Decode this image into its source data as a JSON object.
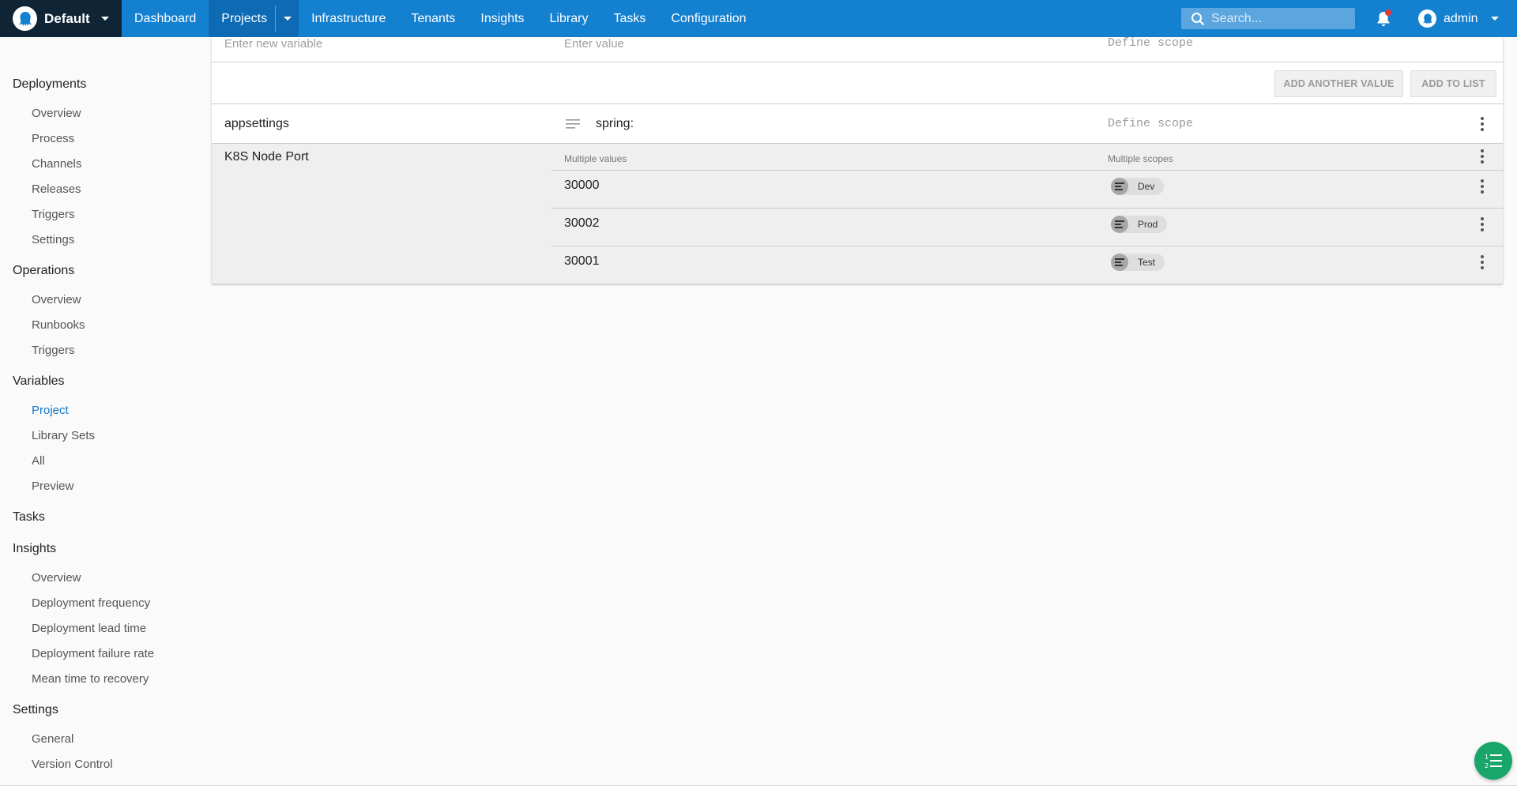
{
  "topbar": {
    "space_name": "Default",
    "nav": [
      "Dashboard",
      "Projects",
      "Infrastructure",
      "Tenants",
      "Insights",
      "Library",
      "Tasks",
      "Configuration"
    ],
    "search_placeholder": "Search...",
    "user_name": "admin"
  },
  "sidebar": {
    "deployments": {
      "title": "Deployments",
      "items": [
        "Overview",
        "Process",
        "Channels",
        "Releases",
        "Triggers",
        "Settings"
      ]
    },
    "operations": {
      "title": "Operations",
      "items": [
        "Overview",
        "Runbooks",
        "Triggers"
      ]
    },
    "variables": {
      "title": "Variables",
      "items": [
        "Project",
        "Library Sets",
        "All",
        "Preview"
      ],
      "selected": "Project"
    },
    "tasks": {
      "title": "Tasks"
    },
    "insights": {
      "title": "Insights",
      "items": [
        "Overview",
        "Deployment frequency",
        "Deployment lead time",
        "Deployment failure rate",
        "Mean time to recovery"
      ]
    },
    "settings": {
      "title": "Settings",
      "items": [
        "General",
        "Version Control"
      ]
    }
  },
  "editor": {
    "new_variable_placeholder": "Enter new variable",
    "new_value_placeholder": "Enter value",
    "new_scope_placeholder": "Define scope",
    "add_another_value": "ADD ANOTHER VALUE",
    "add_to_list": "ADD TO LIST"
  },
  "variables": [
    {
      "name": "appsettings",
      "value": "spring:",
      "scope": "Define scope"
    },
    {
      "name": "K8S Node Port",
      "values_header": "Multiple values",
      "scopes_header": "Multiple scopes",
      "values": [
        {
          "value": "30000",
          "scope": "Dev"
        },
        {
          "value": "30002",
          "scope": "Prod"
        },
        {
          "value": "30001",
          "scope": "Test"
        }
      ]
    }
  ],
  "colors": {
    "topbar": "#1480d0",
    "space_switcher": "#0f2535",
    "selected_link": "#1478c8",
    "fab": "#1aa66a"
  },
  "icons": [
    "octopus-logo-icon",
    "caret-down-icon",
    "search-icon",
    "bell-icon",
    "user-avatar-icon",
    "multiline-text-icon",
    "kebab-menu-icon",
    "environment-icon",
    "task-list-icon"
  ]
}
